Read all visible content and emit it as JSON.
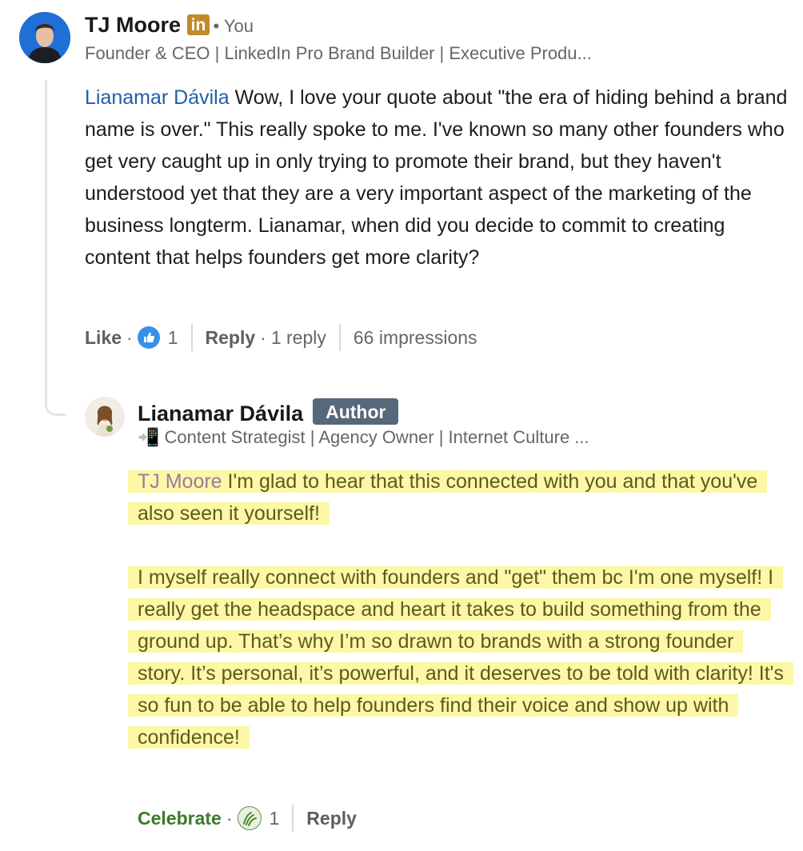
{
  "parent": {
    "author": "TJ Moore",
    "linkedin_badge": "in",
    "relation": "You",
    "headline": "Founder & CEO | LinkedIn Pro Brand Builder | Executive Produ...",
    "mention": "Lianamar Dávila",
    "text": " Wow, I love your quote about \"the era of hiding behind a brand name is over.\" This really spoke to me. I've known so many other founders who get very caught up in only trying to promote their brand, but they haven't understood yet that they are a very important aspect of the marketing of the business longterm. Lianamar, when did you decide to commit to creating content that helps founders get more clarity?",
    "actions": {
      "like_label": "Like",
      "reaction_count": "1",
      "reply_label": "Reply",
      "reply_count": "1 reply",
      "impressions": "66 impressions"
    }
  },
  "reply": {
    "author": "Lianamar Dávila",
    "badge": "Author",
    "headline": "📲 Content Strategist | Agency Owner | Internet Culture ...",
    "mention": "TJ Moore",
    "paragraph1": " I'm glad to hear that this connected with you and that you've also seen it yourself!",
    "paragraph2": "I myself really connect with founders and \"get\" them bc I'm one myself! I really get the headspace and heart it takes to build something from the ground up. That’s why I’m so drawn to brands with a strong founder story. It’s personal, it’s powerful, and it deserves to be told with clarity! It's so fun to be able to help founders find their voice and show up with confidence!",
    "actions": {
      "celebrate_label": "Celebrate",
      "reaction_count": "1",
      "reply_label": "Reply"
    }
  },
  "colors": {
    "highlight": "#fdf7a6",
    "mention_blue": "#1f5fa8",
    "author_badge": "#56687a",
    "linkedin_badge": "#c2892d",
    "celebrate": "#3d7a2a"
  }
}
